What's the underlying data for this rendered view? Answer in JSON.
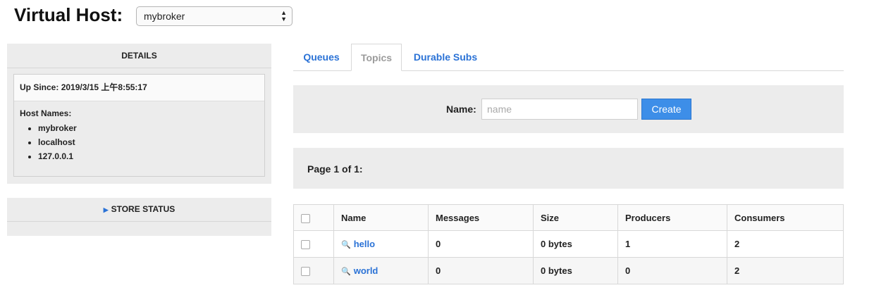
{
  "header": {
    "title": "Virtual Host:",
    "vhost_selected": "mybroker"
  },
  "details": {
    "title": "DETAILS",
    "up_since_label": "Up Since:",
    "up_since_value": "2019/3/15 上午8:55:17",
    "host_names_label": "Host Names:",
    "host_names": [
      "mybroker",
      "localhost",
      "127.0.0.1"
    ]
  },
  "store_status": {
    "title": "STORE STATUS"
  },
  "tabs": [
    {
      "label": "Queues",
      "active": false
    },
    {
      "label": "Topics",
      "active": true
    },
    {
      "label": "Durable Subs",
      "active": false
    }
  ],
  "create": {
    "label": "Name:",
    "placeholder": "name",
    "button": "Create"
  },
  "pager": {
    "text": "Page 1 of 1:"
  },
  "table": {
    "columns": [
      "Name",
      "Messages",
      "Size",
      "Producers",
      "Consumers"
    ],
    "rows": [
      {
        "name": "hello",
        "messages": "0",
        "size": "0 bytes",
        "producers": "1",
        "consumers": "2"
      },
      {
        "name": "world",
        "messages": "0",
        "size": "0 bytes",
        "producers": "0",
        "consumers": "2"
      }
    ]
  },
  "colors": {
    "link": "#2a72d6",
    "panel_bg": "#ececec",
    "button": "#3d8ee8"
  }
}
